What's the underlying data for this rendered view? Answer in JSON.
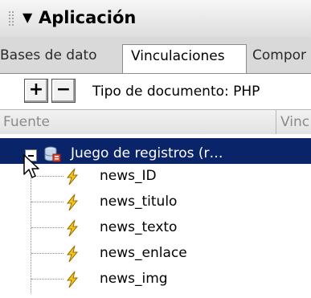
{
  "panel": {
    "title": "Aplicación",
    "colors": {
      "selection": "#0a246a",
      "bolt": "#f5c518",
      "tab_bg": "#d9d9d9"
    }
  },
  "tabs": [
    {
      "label": "Bases de dato",
      "selected": false
    },
    {
      "label": "Vinculaciones",
      "selected": true
    },
    {
      "label": "Compor",
      "selected": false
    }
  ],
  "toolbar": {
    "add_label": "+",
    "remove_label": "−",
    "doc_type": "Tipo de documento: PHP"
  },
  "columns": {
    "source": "Fuente",
    "binding": "Vinc"
  },
  "tree": {
    "recordset_label": "Juego de registros (r…",
    "recordset_icon": "database-icon",
    "field_icon": "lightning-bolt-icon",
    "fields": [
      "news_ID",
      "news_titulo",
      "news_texto",
      "news_enlace",
      "news_img"
    ]
  }
}
